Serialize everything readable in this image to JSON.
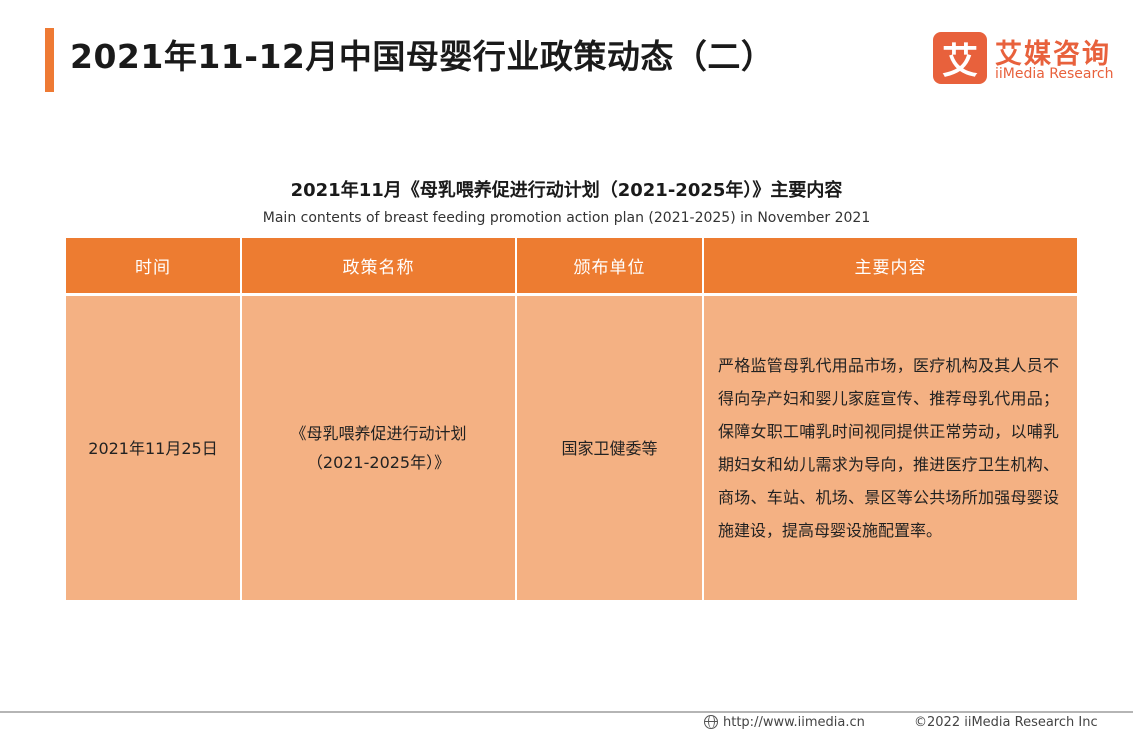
{
  "header": {
    "title": "2021年11-12月中国母婴行业政策动态（二）"
  },
  "logo": {
    "mark": "艾",
    "name_cn": "艾媒咨询",
    "name_en": "iiMedia Research"
  },
  "table": {
    "title": "2021年11月《母乳喂养促进行动计划（2021-2025年）》主要内容",
    "subtitle": "Main contents of breast feeding promotion action plan (2021-2025) in November 2021",
    "headers": [
      "时间",
      "政策名称",
      "颁布单位",
      "主要内容"
    ],
    "rows": [
      {
        "date": "2021年11月25日",
        "policy_name_line1": "《母乳喂养促进行动计划",
        "policy_name_line2": "（2021-2025年）》",
        "issuer": "国家卫健委等",
        "content": "严格监管母乳代用品市场，医疗机构及其人员不得向孕产妇和婴儿家庭宣传、推荐母乳代用品；保障女职工哺乳时间视同提供正常劳动，以哺乳期妇女和幼儿需求为导向，推进医疗卫生机构、商场、车站、机场、景区等公共场所加强母婴设施建设，提高母婴设施配置率。"
      }
    ]
  },
  "footer": {
    "url": "http://www.iimedia.cn",
    "copyright": "©2022  iiMedia Research  Inc"
  },
  "colors": {
    "accent": "#ee7a34",
    "header_fill": "#ed7c31",
    "cell_fill": "#f4b183",
    "logo": "#e8613c"
  }
}
